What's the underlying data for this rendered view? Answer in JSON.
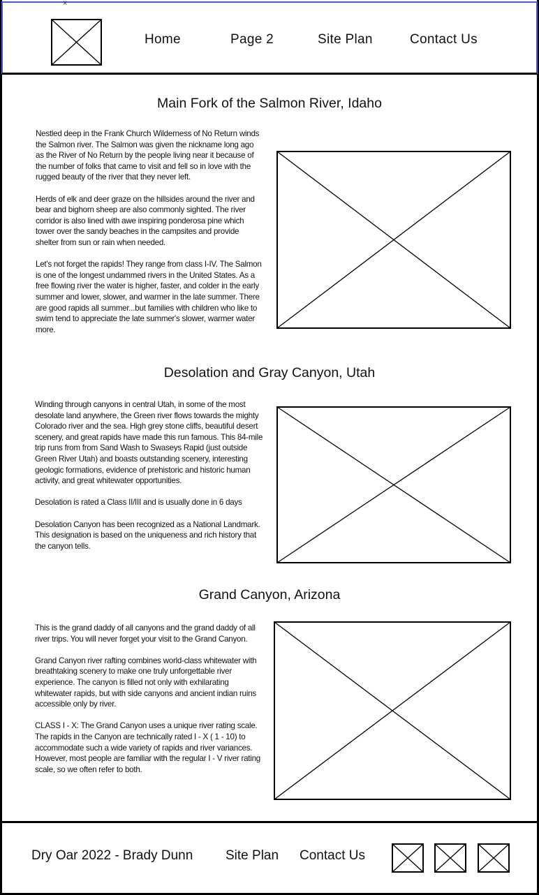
{
  "header": {
    "logo_icon": "image-placeholder-icon",
    "nav": [
      {
        "label": "Home"
      },
      {
        "label": "Page 2"
      },
      {
        "label": "Site Plan"
      },
      {
        "label": "Contact Us"
      }
    ]
  },
  "sections": [
    {
      "title": "Main Fork of the Salmon River, Idaho",
      "paragraphs": [
        "Nestled deep in the Frank Church Wilderness of No Return winds the Salmon river. The Salmon was given the nickname long ago as the River of No Return by the people living near it because of the number of folks that came to visit and fell so in love with the rugged beauty of the river that they never left.",
        "Herds of elk and deer graze on the hillsides around the river and bear and bighorn sheep are also commonly sighted. The river corridor is also lined with awe inspiring ponderosa pine which tower over the sandy beaches in the campsites and provide shelter from sun or rain when needed.",
        "Let's not forget the rapids! They range from class I-IV. The Salmon is one of the longest undammed rivers in the United States. As a free flowing river the water is higher, faster, and colder in the early summer and lower, slower, and warmer in the late summer. There are good rapids all summer...but families with children who like to swim tend to appreciate the late summer's slower, warmer water more."
      ]
    },
    {
      "title": "Desolation and Gray Canyon, Utah",
      "paragraphs": [
        "Winding through canyons in central Utah, in some of the most desolate land anywhere, the Green river flows towards the mighty Colorado river and the sea. High grey stone cliffs, beautiful desert scenery, and great rapids have made this run famous. This 84-mile trip runs from from Sand Wash to Swaseys Rapid (just outside Green River Utah) and boasts outstanding scenery, interesting geologic formations, evidence of prehistoric and historic human activity, and great whitewater opportunities.",
        "Desolation is rated a Class II/III and is usually done in 6 days",
        "Desolation Canyon has been recognized as a National Landmark.  This designation is based on the uniqueness and rich history that the canyon tells."
      ]
    },
    {
      "title": "Grand Canyon, Arizona",
      "paragraphs": [
        "This is the grand daddy of all canyons and the grand daddy of all river trips. You will never forget your visit to the Grand Canyon.",
        "Grand Canyon river rafting combines world-class whitewater with breathtaking scenery to make one truly unforgettable river experience. The canyon is filled not only with exhilarating whitewater rapids, but with side canyons and ancient indian ruins accessible only by river.",
        "CLASS I - X: The Grand Canyon uses a unique river rating scale. The rapids in the Canyon are technically rated I - X ( 1 - 10) to accommodate such a wide variety of rapids and river variances. However, most people are familiar with the regular I - V river rating scale, so we often refer to both."
      ]
    }
  ],
  "footer": {
    "copyright": "Dry Oar 2022 - Brady Dunn",
    "site_plan": "Site Plan",
    "contact": "Contact Us",
    "social_icons": [
      "image-placeholder-icon",
      "image-placeholder-icon",
      "image-placeholder-icon"
    ]
  }
}
